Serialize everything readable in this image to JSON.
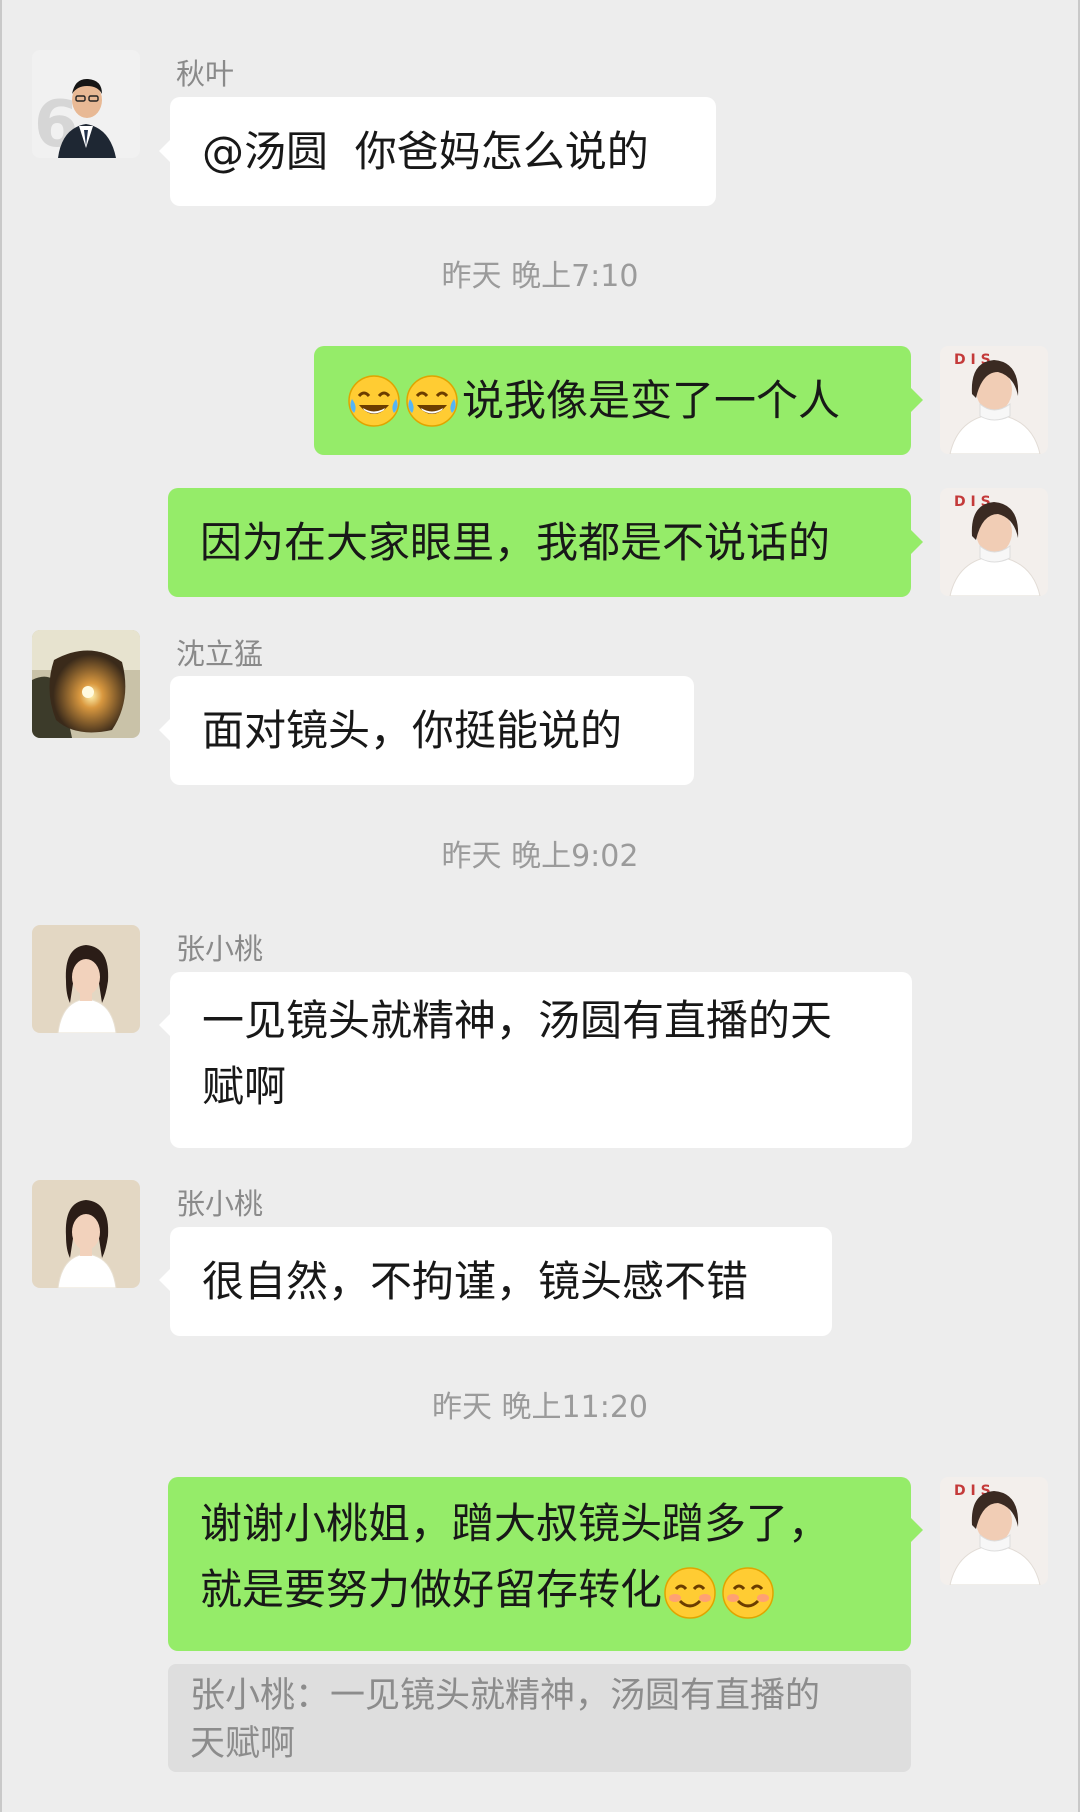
{
  "colors": {
    "background": "#ededed",
    "bubble_self": "#95ec69",
    "bubble_other": "#ffffff",
    "quote_bg": "#dedede"
  },
  "messages": [
    {
      "sender": "秋叶",
      "text": "@汤圆  你爸妈怎么说的"
    },
    {
      "timestamp": "昨天 晚上7:10"
    },
    {
      "self": true,
      "emoji": [
        "tears-of-joy-emoji",
        "tears-of-joy-emoji"
      ],
      "text": "说我像是变了一个人"
    },
    {
      "self": true,
      "text": "因为在大家眼里，我都是不说话的"
    },
    {
      "sender": "沈立猛",
      "text": "面对镜头，你挺能说的"
    },
    {
      "timestamp": "昨天 晚上9:02"
    },
    {
      "sender": "张小桃",
      "text": "一见镜头就精神，汤圆有直播的天\n赋啊"
    },
    {
      "sender": "张小桃",
      "text": "很自然，不拘谨，镜头感不错"
    },
    {
      "timestamp": "昨天 晚上11:20"
    },
    {
      "self": true,
      "text": "谢谢小桃姐，蹭大叔镜头蹭多了，\n就是要努力做好留存转化",
      "emoji_after": [
        "smiling-blush-emoji",
        "smiling-blush-emoji"
      ],
      "quote": "张小桃：一见镜头就精神，汤圆有直播的\n天赋啊"
    }
  ]
}
